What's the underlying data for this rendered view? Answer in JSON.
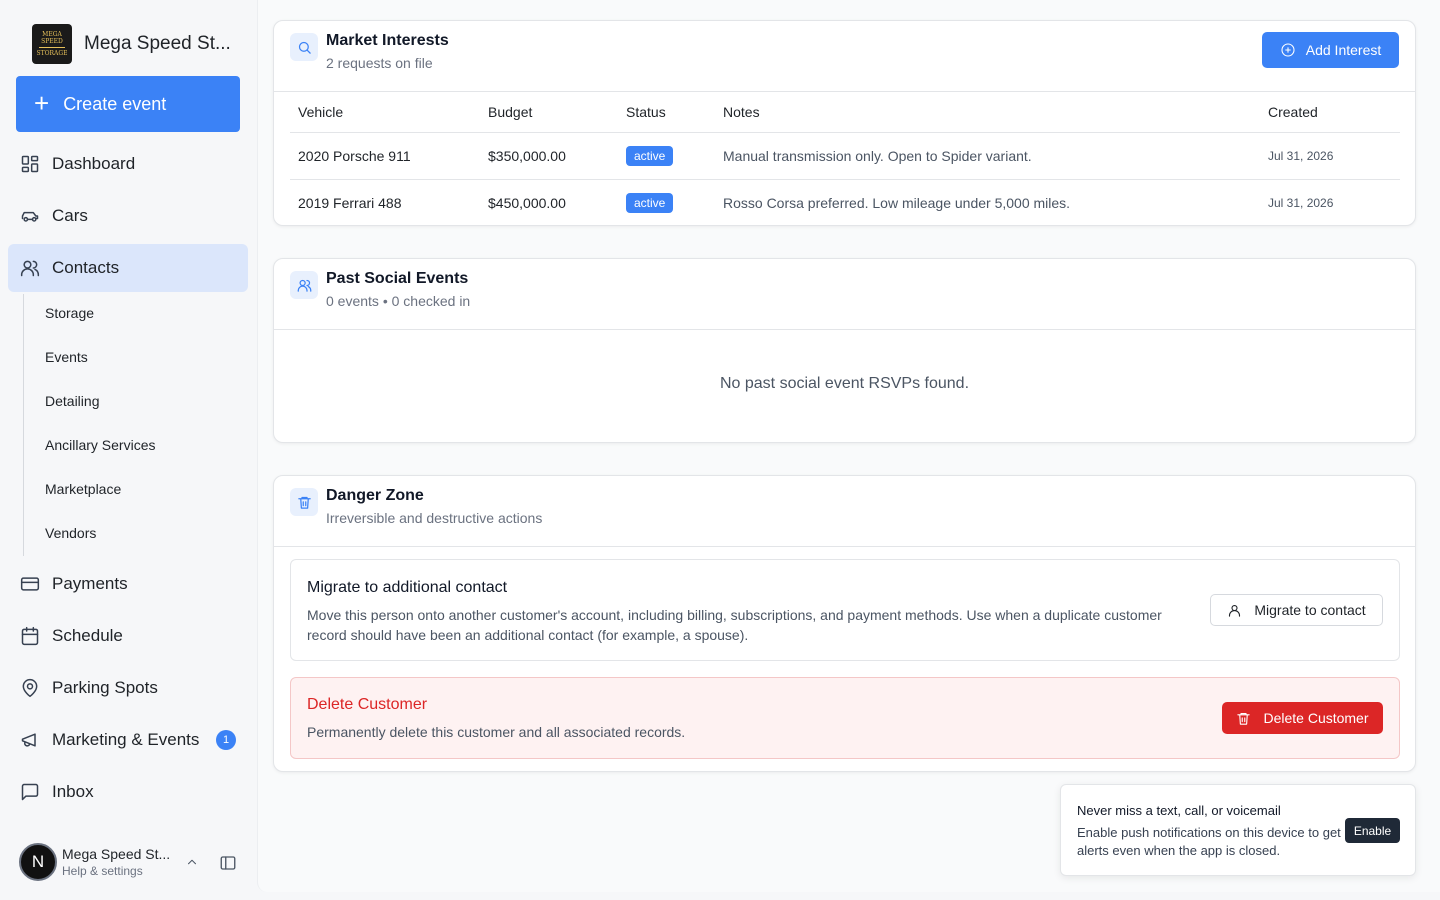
{
  "brand": {
    "name": "Mega Speed St...",
    "logo_text": "MEGA SPEED STORAGE",
    "logo_top": "MEGA SPEED",
    "logo_bottom": "STORAGE"
  },
  "create_button": {
    "label": "Create event"
  },
  "nav": {
    "dashboard": "Dashboard",
    "cars": "Cars",
    "contacts": "Contacts",
    "payments": "Payments",
    "schedule": "Schedule",
    "parking": "Parking Spots",
    "marketing": "Marketing & Events",
    "marketing_badge": "1",
    "inbox": "Inbox"
  },
  "subnav": {
    "storage": "Storage",
    "events": "Events",
    "detailing": "Detailing",
    "ancillary": "Ancillary Services",
    "marketplace": "Marketplace",
    "vendors": "Vendors"
  },
  "user": {
    "initial": "N",
    "name": "Mega Speed St...",
    "sub": "Help & settings"
  },
  "market_interests": {
    "title": "Market Interests",
    "subtitle": "2 requests on file",
    "add_label": "Add Interest",
    "columns": {
      "vehicle": "Vehicle",
      "budget": "Budget",
      "status": "Status",
      "notes": "Notes",
      "created": "Created"
    },
    "rows": [
      {
        "vehicle": "2020 Porsche 911",
        "budget": "$350,000.00",
        "status": "active",
        "notes": "Manual transmission only. Open to Spider variant.",
        "created": "Jul 31, 2026"
      },
      {
        "vehicle": "2019 Ferrari 488",
        "budget": "$450,000.00",
        "status": "active",
        "notes": "Rosso Corsa preferred. Low mileage under 5,000 miles.",
        "created": "Jul 31, 2026"
      }
    ]
  },
  "past_events": {
    "title": "Past Social Events",
    "subtitle": "0 events • 0 checked in",
    "empty": "No past social event RSVPs found."
  },
  "danger_zone": {
    "title": "Danger Zone",
    "subtitle": "Irreversible and destructive actions",
    "migrate": {
      "title": "Migrate to additional contact",
      "description": "Move this person onto another customer's account, including billing, subscriptions, and payment methods. Use when a duplicate customer record should have been an additional contact (for example, a spouse).",
      "button": "Migrate to contact"
    },
    "delete": {
      "title": "Delete Customer",
      "description": "Permanently delete this customer and all associated records.",
      "button": "Delete Customer"
    }
  },
  "toast": {
    "title": "Never miss a text, call, or voicemail",
    "body": "Enable push notifications on this device to get alerts even when the app is closed.",
    "button": "Enable"
  },
  "colors": {
    "accent": "#3b82f6",
    "danger": "#dc2626",
    "active_nav": "#dbe6fb"
  }
}
